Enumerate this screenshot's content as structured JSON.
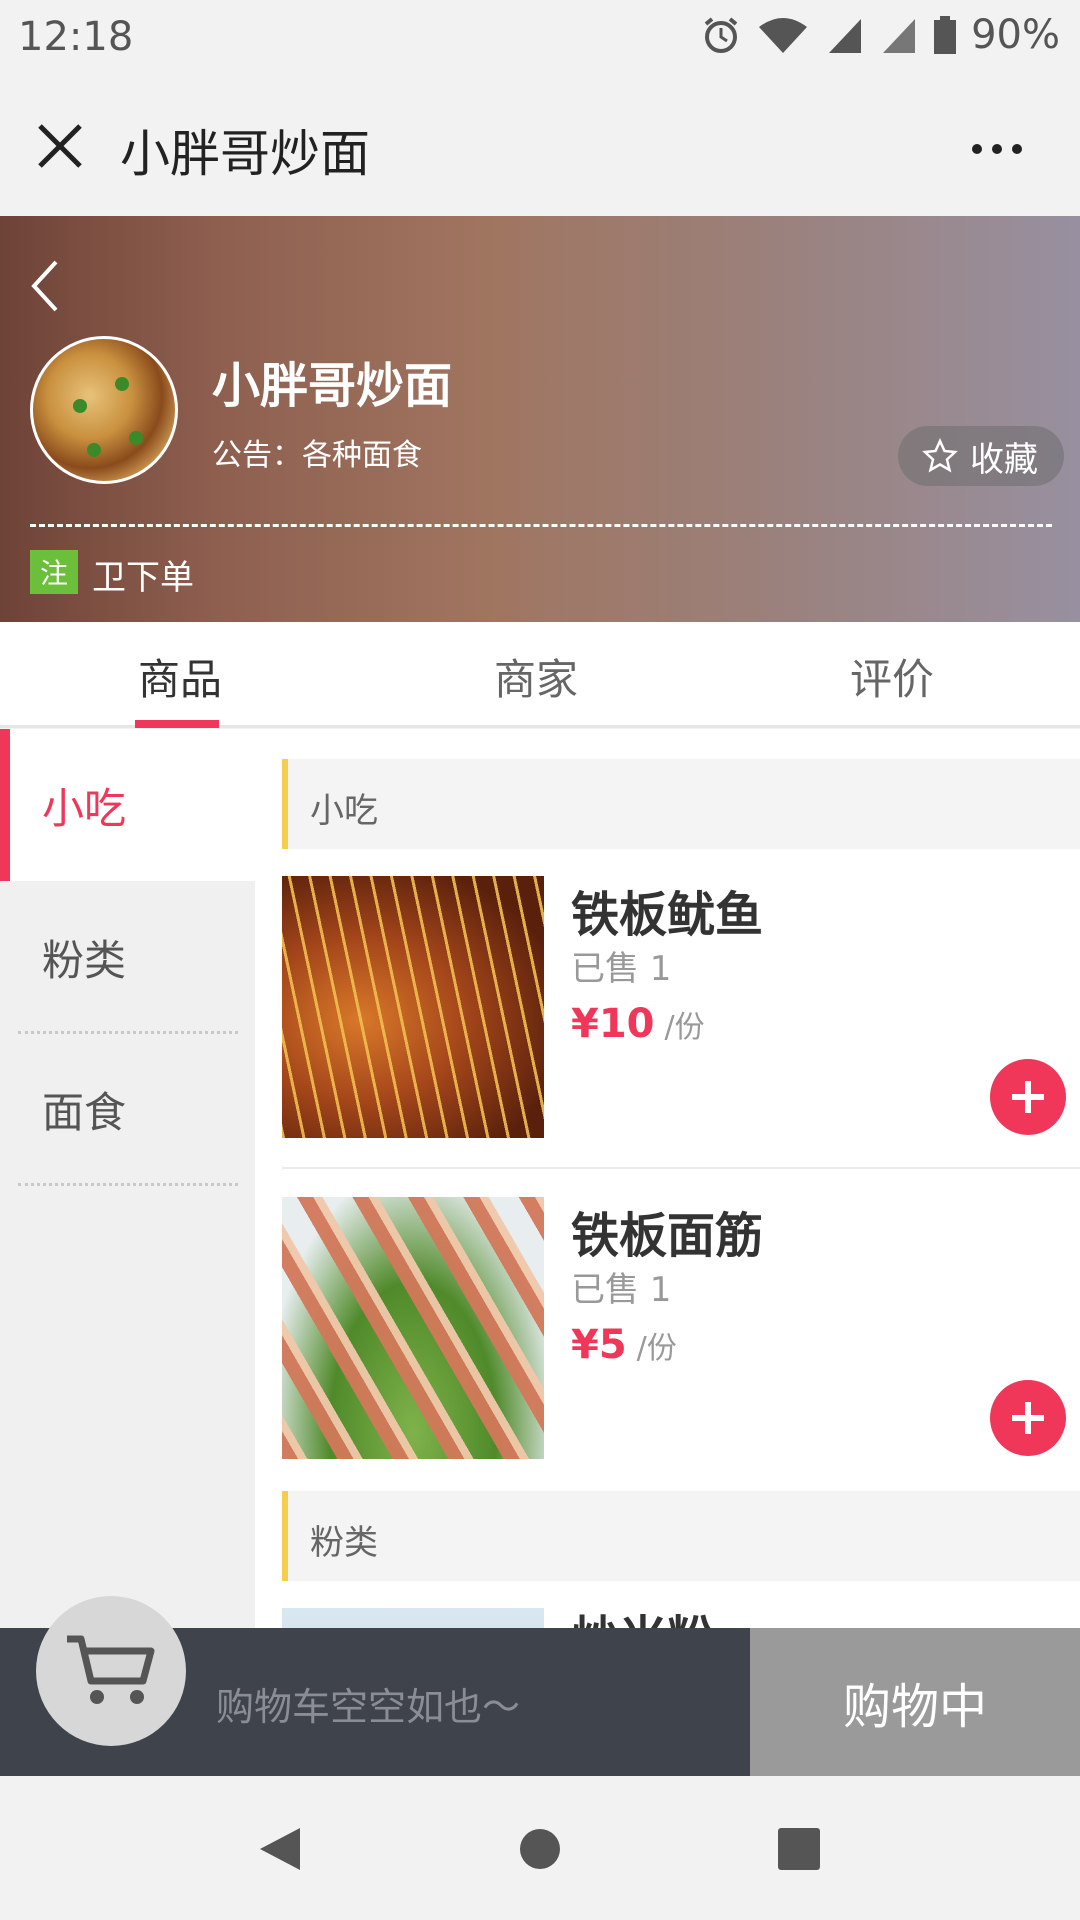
{
  "status_bar": {
    "time": "12:18",
    "battery": "90%"
  },
  "title_bar": {
    "title": "小胖哥炒面"
  },
  "shop": {
    "name": "小胖哥炒面",
    "notice": "公告：各种面食",
    "favorite_label": "收藏",
    "promo_badge": "注",
    "promo_text": "卫下单"
  },
  "tabs": [
    {
      "label": "商品",
      "active": true
    },
    {
      "label": "商家",
      "active": false
    },
    {
      "label": "评价",
      "active": false
    }
  ],
  "categories": [
    {
      "label": "小吃",
      "active": true
    },
    {
      "label": "粉类",
      "active": false
    },
    {
      "label": "面食",
      "active": false
    }
  ],
  "sections": [
    {
      "title": "小吃",
      "items": [
        {
          "name": "铁板鱿鱼",
          "sold": "已售 1",
          "price": "¥10",
          "unit": "/份",
          "image": "grilled-squid-skewers"
        },
        {
          "name": "铁板面筋",
          "sold": "已售 1",
          "price": "¥5",
          "unit": "/份",
          "image": "grilled-gluten-skewers"
        }
      ]
    },
    {
      "title": "粉类",
      "items": [
        {
          "name": "炒米粉",
          "image": "fried-rice-noodles"
        }
      ]
    }
  ],
  "cart": {
    "empty_text": "购物车空空如也～",
    "checkout_label": "购物中"
  },
  "colors": {
    "accent": "#f0375a",
    "section_marker": "#f5cd4f",
    "cart_bar": "#3f434b",
    "checkout": "#9a9a9a",
    "promo_badge": "#6cbf3a"
  },
  "icons": [
    "close-icon",
    "more-icon",
    "back-arrow-icon",
    "star-icon",
    "add-icon",
    "cart-icon",
    "nav-back-icon",
    "nav-home-icon",
    "nav-recents-icon",
    "alarm-icon",
    "wifi-icon",
    "signal-icon",
    "battery-icon"
  ]
}
